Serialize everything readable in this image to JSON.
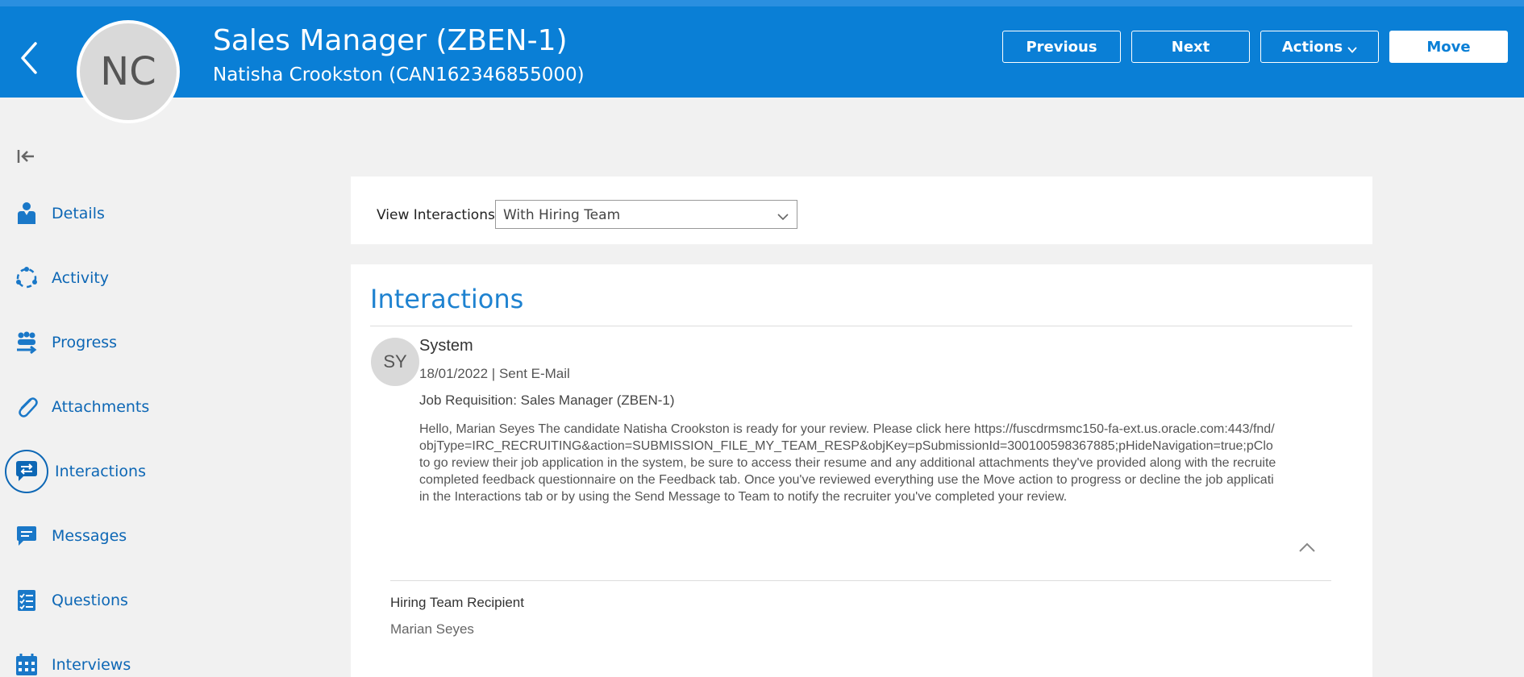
{
  "header": {
    "avatar_initials": "NC",
    "title": "Sales Manager (ZBEN-1)",
    "subtitle": "Natisha Crookston (CAN162346855000)",
    "buttons": {
      "previous": "Previous",
      "next": "Next",
      "actions": "Actions",
      "move": "Move"
    },
    "colors": {
      "bar": "#0a7fd6",
      "accent": "#0d67b5"
    }
  },
  "sidebar": {
    "items": [
      {
        "label": "Details",
        "icon": "person-icon"
      },
      {
        "label": "Activity",
        "icon": "activity-cycle-icon"
      },
      {
        "label": "Progress",
        "icon": "team-progress-icon"
      },
      {
        "label": "Attachments",
        "icon": "paperclip-icon"
      },
      {
        "label": "Interactions",
        "icon": "interactions-chat-icon",
        "active": true
      },
      {
        "label": "Messages",
        "icon": "message-bubble-icon"
      },
      {
        "label": "Questions",
        "icon": "checklist-icon"
      },
      {
        "label": "Interviews",
        "icon": "calendar-icon"
      }
    ]
  },
  "filter": {
    "label": "View Interactions",
    "selected": "With Hiring Team"
  },
  "interactions": {
    "title": "Interactions",
    "entry": {
      "avatar_initials": "SY",
      "sender": "System",
      "meta": "18/01/2022 | Sent E-Mail",
      "job": "Job Requisition: Sales Manager (ZBEN-1)",
      "message_lines": [
        "Hello, Marian Seyes The candidate Natisha Crookston is ready for your review. Please click here https://fuscdrmsmc150-fa-ext.us.oracle.com:443/fnd/",
        "objType=IRC_RECRUITING&action=SUBMISSION_FILE_MY_TEAM_RESP&objKey=pSubmissionId=300100598367885;pHideNavigation=true;pClo",
        "to go review their job application in the system, be sure to access their resume and any additional attachments they've provided along with the recruite",
        "completed feedback questionnaire on the Feedback tab. Once you've reviewed everything use the Move action to progress or decline the job applicati",
        "in the Interactions tab or by using the Send Message to Team to notify the recruiter you've completed your review."
      ],
      "recipient_label": "Hiring Team Recipient",
      "recipient_name": "Marian Seyes"
    }
  }
}
